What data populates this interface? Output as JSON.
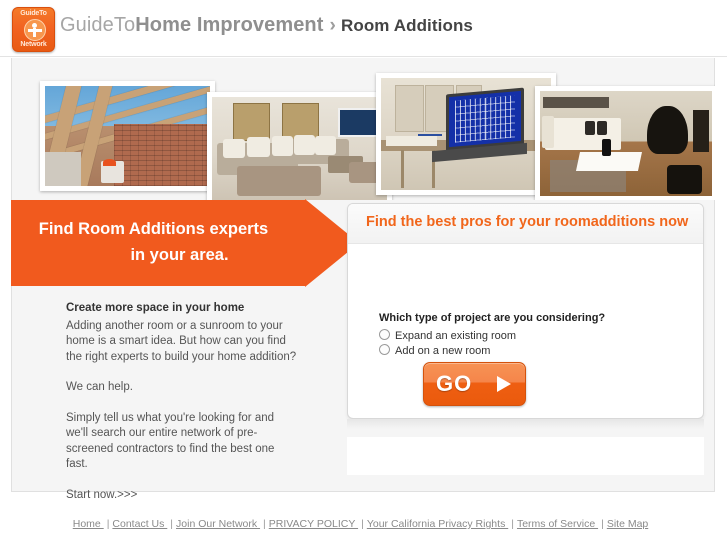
{
  "header": {
    "logo": {
      "top_text": "GuideTo",
      "bottom_text": "Network",
      "icon": "person-figure-icon"
    },
    "brand_part1": "GuideTo",
    "brand_part2": "Home Improvement",
    "separator": "›",
    "breadcrumb_current": "Room Additions"
  },
  "photos": [
    {
      "alt": "roof-framing-construction"
    },
    {
      "alt": "living-room-sofas-tv"
    },
    {
      "alt": "desk-laptop-blueprint"
    },
    {
      "alt": "white-sofa-black-chair-interior"
    }
  ],
  "banner": {
    "line1": "Find Room Additions experts",
    "line2": "in your area."
  },
  "left_copy": {
    "heading": "Create more space in your home",
    "paragraph1": "Adding another room or a sunroom to your home is a smart idea. But how can you find the right experts to build your home addition?",
    "paragraph2": "We can help.",
    "paragraph3": "Simply tell us what you're looking for and we'll search our entire network of pre-screened contractors to find the best one fast.",
    "paragraph4": "Start now.>>>"
  },
  "form": {
    "title": "Find the best pros for your roomadditions now",
    "question": "Which type of project are you considering?",
    "options": [
      {
        "label": "Expand an existing room",
        "selected": false
      },
      {
        "label": "Add on a new room",
        "selected": false
      }
    ],
    "submit_label": "GO",
    "submit_icon": "play-triangle-icon"
  },
  "footer": {
    "links": [
      "Home",
      "Contact Us",
      "Join Our Network",
      "PRIVACY POLICY",
      "Your California Privacy Rights",
      "Terms of Service",
      "Site Map"
    ],
    "separator": "|"
  },
  "colors": {
    "orange": "#f15a1e",
    "orange_title": "#f1661b",
    "page_bg": "#f5f5f5",
    "text_gray": "#555555"
  }
}
